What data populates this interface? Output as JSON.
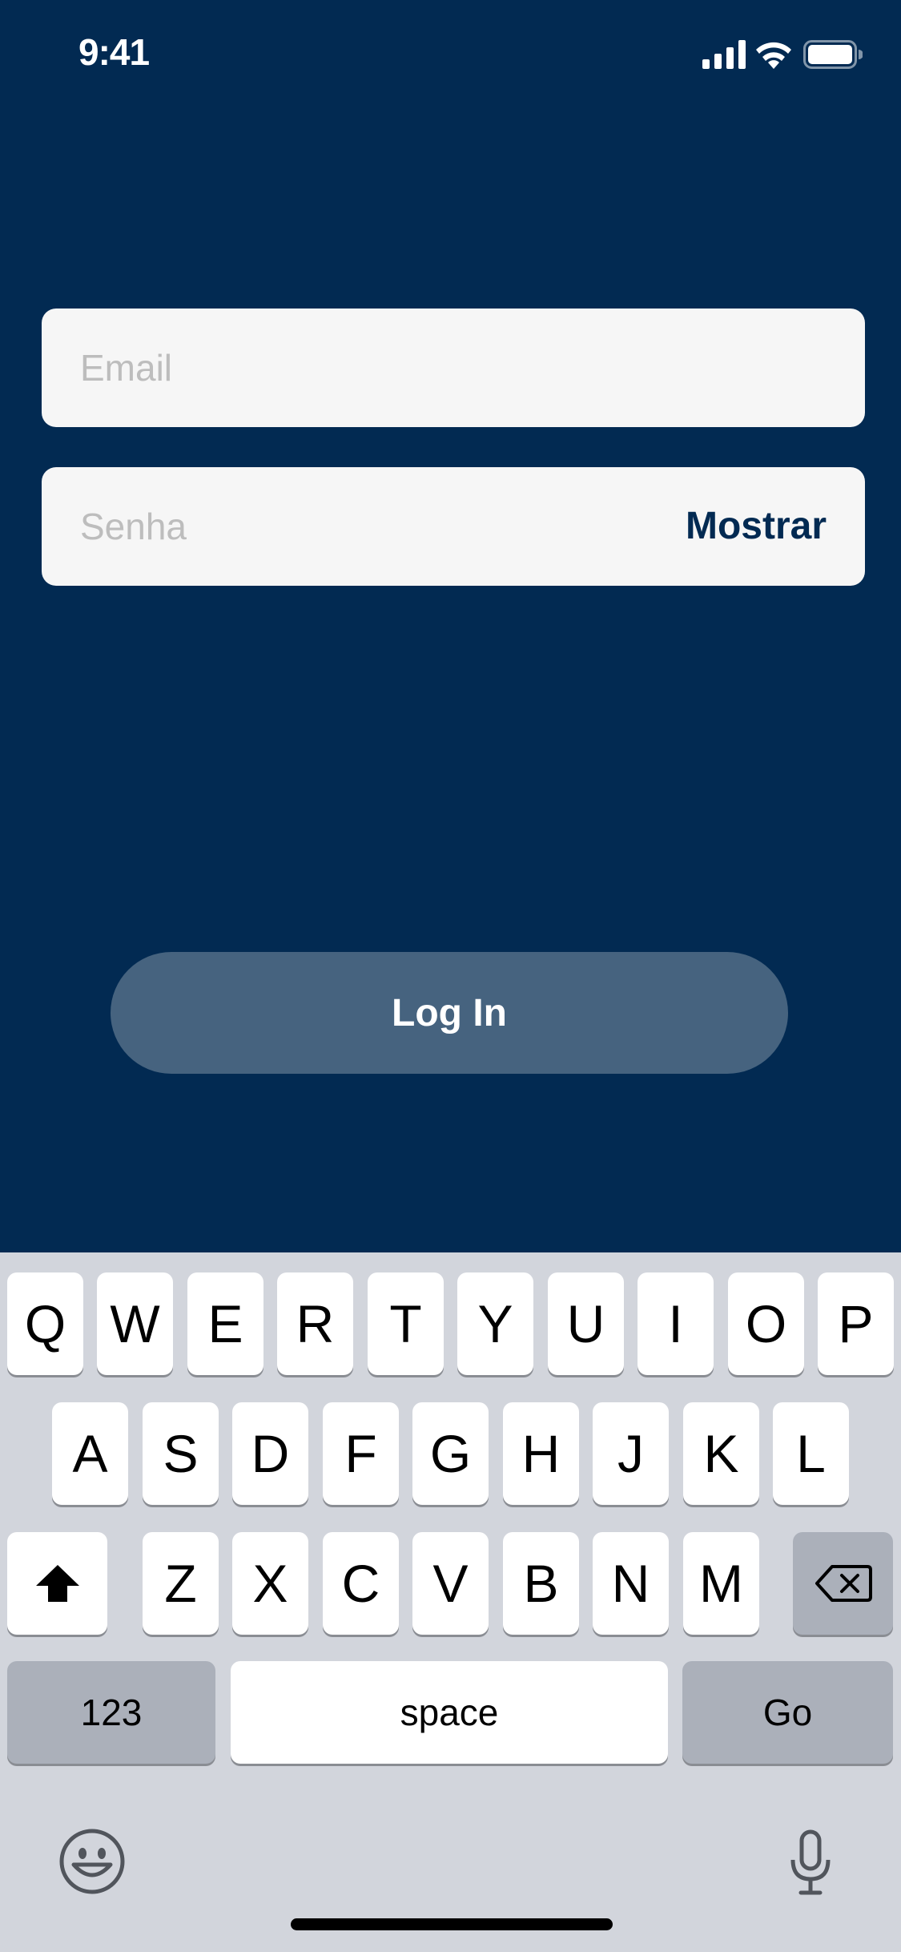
{
  "status_bar": {
    "time": "9:41",
    "signal_icon": "cellular-signal-icon",
    "wifi_icon": "wifi-icon",
    "battery_icon": "battery-icon"
  },
  "form": {
    "email": {
      "placeholder": "Email",
      "value": ""
    },
    "password": {
      "placeholder": "Senha",
      "value": "",
      "toggle_label": "Mostrar"
    },
    "login_label": "Log In"
  },
  "colors": {
    "background": "#022A52",
    "login_button": "#46637F",
    "field": "#F6F6F6",
    "keyboard": "#D2D5DC"
  },
  "keyboard": {
    "row1": [
      "Q",
      "W",
      "E",
      "R",
      "T",
      "Y",
      "U",
      "I",
      "O",
      "P"
    ],
    "row2": [
      "A",
      "S",
      "D",
      "F",
      "G",
      "H",
      "J",
      "K",
      "L"
    ],
    "row3": [
      "Z",
      "X",
      "C",
      "V",
      "B",
      "N",
      "M"
    ],
    "numbers_label": "123",
    "space_label": "space",
    "go_label": "Go",
    "shift_icon": "shift-icon",
    "delete_icon": "delete-icon",
    "emoji_icon": "emoji-icon",
    "mic_icon": "microphone-icon"
  }
}
